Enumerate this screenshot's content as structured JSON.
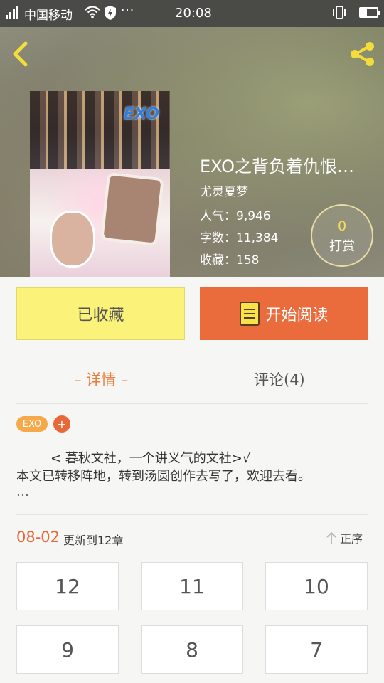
{
  "status_bar": {
    "carrier": "中国移动",
    "time": "20:08",
    "more_dots": "···",
    "colors": {
      "background": "#4a4a46"
    }
  },
  "nav": {
    "back_icon": "chevron-left-icon",
    "share_icon": "share-icon",
    "accent_color": "#f2dd3c"
  },
  "book": {
    "cover_logo": "EXO",
    "title": "EXO之背负着仇恨…",
    "author": "尤灵夏梦",
    "popularity": "人气：9,946",
    "word_count": "字数：11,384",
    "favorites": "收藏：158",
    "tip_count": "0",
    "tip_label": "打赏"
  },
  "actions": {
    "favorited_label": "已收藏",
    "read_label": "开始阅读",
    "read_icon": "book-icon",
    "colors": {
      "favorited": "#fbf27a",
      "read": "#ea6b3c"
    }
  },
  "tabs": [
    {
      "label": "– 详情 –",
      "active": true
    },
    {
      "label": "评论(4)",
      "active": false
    }
  ],
  "tags": {
    "items": [
      "EXO"
    ],
    "add_label": "+"
  },
  "description": {
    "line1": "< 暮秋文社，一个讲义气的文社>√",
    "line2": "本文已转移阵地，转到汤圆创作去写了，欢迎去看。",
    "more": "…"
  },
  "update": {
    "date": "08-02",
    "text": "更新到12章",
    "sort_label": "正序",
    "sort_icon": "arrow-up-icon"
  },
  "chapters": [
    "12",
    "11",
    "10",
    "9",
    "8",
    "7"
  ]
}
